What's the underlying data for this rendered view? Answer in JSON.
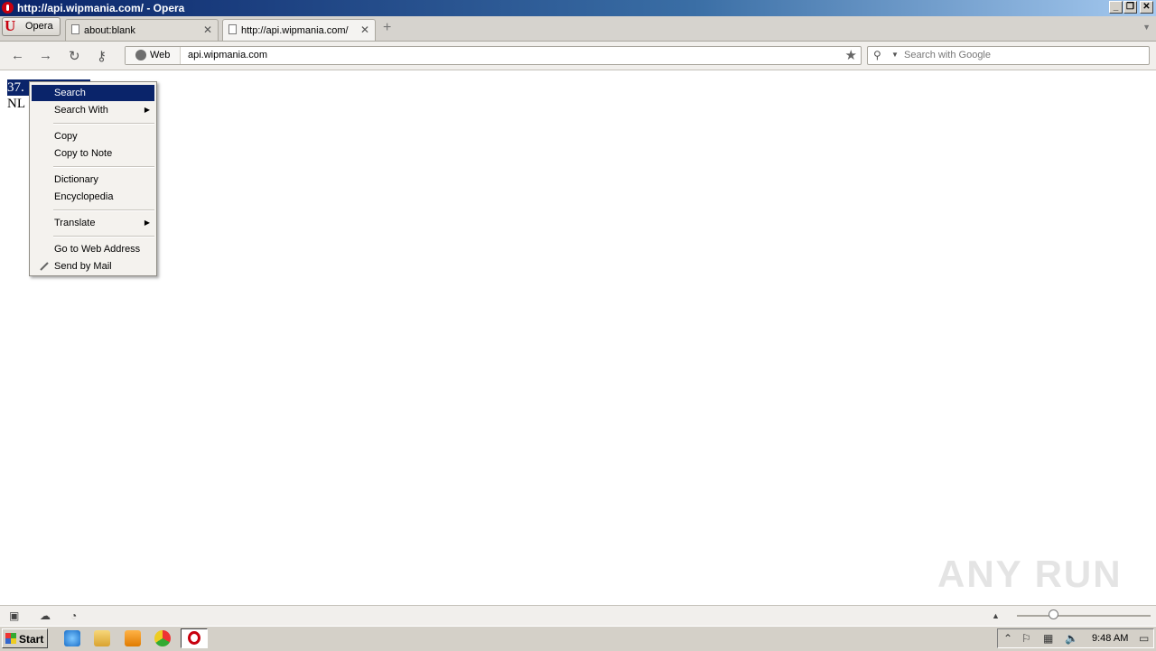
{
  "window": {
    "title": "http://api.wipmania.com/ - Opera",
    "buttons": [
      "_",
      "❐",
      "✕"
    ]
  },
  "tabs": {
    "menu_label": "Opera",
    "items": [
      {
        "label": "about:blank",
        "active": false
      },
      {
        "label": "http://api.wipmania.com/",
        "active": true
      }
    ],
    "new_tab": "+"
  },
  "navbar": {
    "web_badge": "Web",
    "url": "api.wipmania.com",
    "search_placeholder": "Search with Google"
  },
  "page": {
    "line1": "37.",
    "line2": "NL"
  },
  "context_menu": {
    "items": [
      {
        "label": "Search",
        "highlighted": true
      },
      {
        "label": "Search With",
        "submenu": true
      },
      {
        "label": "Copy"
      },
      {
        "label": "Copy to Note"
      },
      {
        "label": "Dictionary"
      },
      {
        "label": "Encyclopedia"
      },
      {
        "label": "Translate",
        "submenu": true
      },
      {
        "label": "Go to Web Address"
      },
      {
        "label": "Send by Mail"
      }
    ]
  },
  "taskbar": {
    "start_label": "Start",
    "clock": "9:48 AM"
  },
  "watermark": "ANY RUN",
  "colors": {
    "title_bar": "#0a246a",
    "selection": "#0a246a",
    "opera_red": "#c8000e",
    "taskbar": "#d4d0c8"
  }
}
